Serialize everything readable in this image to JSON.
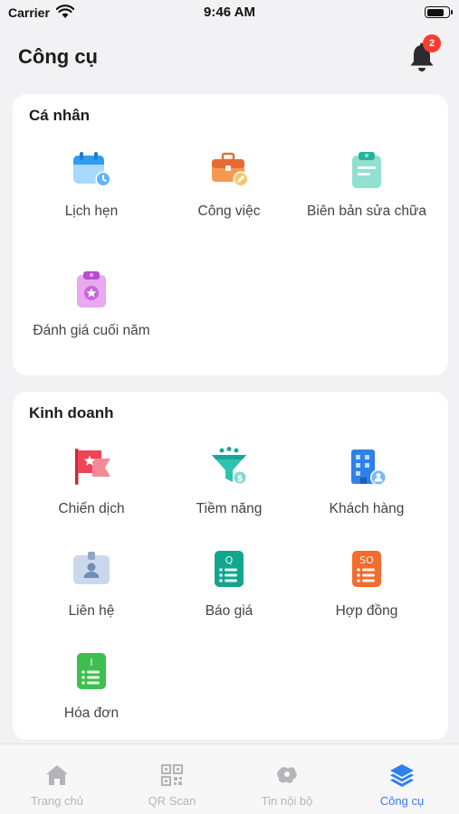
{
  "status_bar": {
    "carrier": "Carrier",
    "time": "9:46 AM",
    "battery_level": 0.85
  },
  "header": {
    "title": "Công cụ",
    "notification_count": "2"
  },
  "sections": [
    {
      "title": "Cá nhân",
      "items": [
        {
          "label": "Lịch hẹn",
          "icon": "calendar-icon"
        },
        {
          "label": "Công việc",
          "icon": "briefcase-icon"
        },
        {
          "label": "Biên bản sửa chữa",
          "icon": "clipboard-icon"
        },
        {
          "label": "Đánh giá cuối năm",
          "icon": "clipboard-star-icon"
        }
      ]
    },
    {
      "title": "Kinh doanh",
      "items": [
        {
          "label": "Chiến dịch",
          "icon": "flag-icon"
        },
        {
          "label": "Tiềm năng",
          "icon": "funnel-icon"
        },
        {
          "label": "Khách hàng",
          "icon": "building-icon"
        },
        {
          "label": "Liên hệ",
          "icon": "id-card-icon"
        },
        {
          "label": "Báo giá",
          "icon": "quote-doc-icon",
          "glyph": "Q"
        },
        {
          "label": "Hợp đồng",
          "icon": "contract-doc-icon",
          "glyph": "SO"
        },
        {
          "label": "Hóa đơn",
          "icon": "invoice-doc-icon",
          "glyph": "I"
        }
      ]
    }
  ],
  "tabs": [
    {
      "label": "Trang chủ",
      "icon": "home-icon",
      "active": false
    },
    {
      "label": "QR Scan",
      "icon": "qr-icon",
      "active": false
    },
    {
      "label": "Tin nội bộ",
      "icon": "news-icon",
      "active": false
    },
    {
      "label": "Công cụ",
      "icon": "layers-icon",
      "active": true
    }
  ],
  "colors": {
    "accent": "#2f80ed",
    "badge": "#ff3b30",
    "inactive_tab": "#b5b5b8"
  }
}
